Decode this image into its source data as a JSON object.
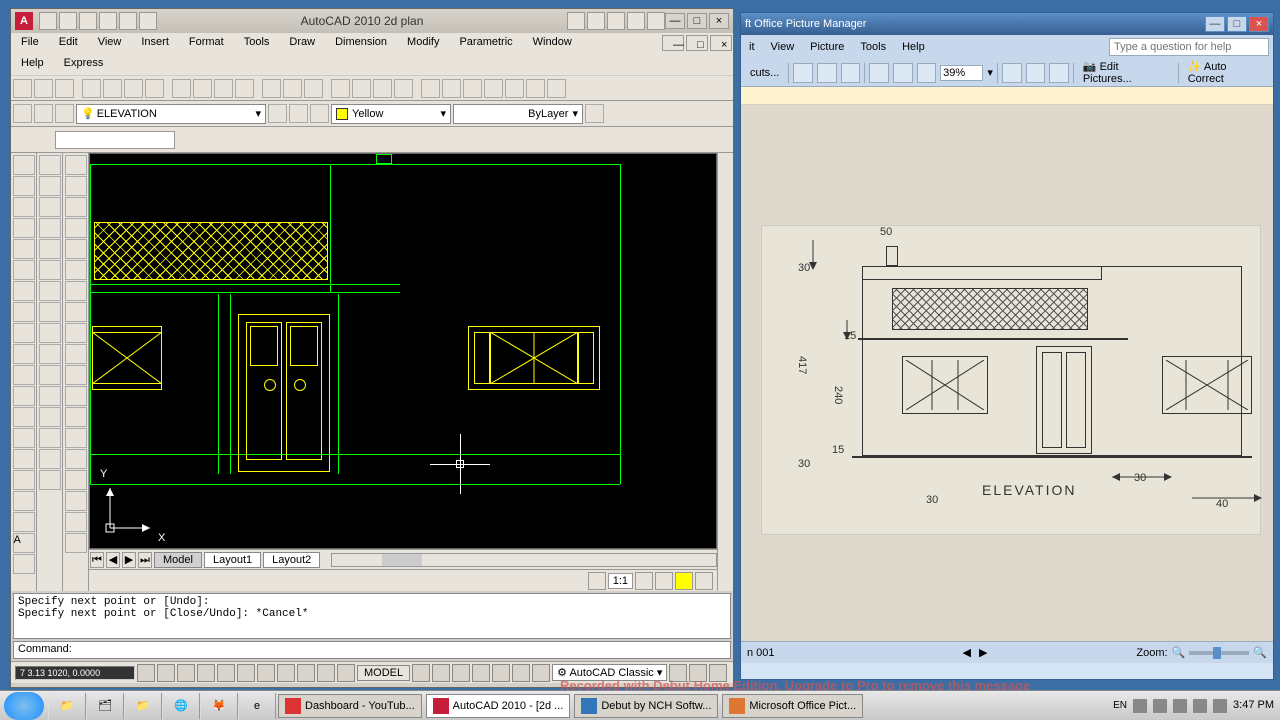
{
  "autocad": {
    "title": "AutoCAD 2010    2d plan",
    "menu": [
      "File",
      "Edit",
      "View",
      "Insert",
      "Format",
      "Tools",
      "Draw",
      "Dimension",
      "Modify",
      "Parametric",
      "Window"
    ],
    "menu2": [
      "Help",
      "Express"
    ],
    "layer": "ELEVATION",
    "color": "Yellow",
    "linetype": "ByLayer",
    "tabs": {
      "nav": [
        "|◀",
        "◀",
        "▶",
        "▶|"
      ],
      "model": "Model",
      "l1": "Layout1",
      "l2": "Layout2"
    },
    "scale": "1:1",
    "cmd_hist": "Specify next point or [Undo]:\nSpecify next point or [Close/Undo]: *Cancel*",
    "cmd_prompt": "Command:",
    "coords": "7   3.13 1020, 0.0000",
    "status_model": "MODEL",
    "status_ws": "AutoCAD Classic",
    "ucs": {
      "x": "X",
      "y": "Y"
    }
  },
  "pm": {
    "title": "ft Office Picture Manager",
    "menu": [
      "it",
      "View",
      "Picture",
      "Tools",
      "Help"
    ],
    "help_ph": "Type a question for help",
    "toolbar": {
      "cuts": "cuts...",
      "zoom": "39%",
      "edit": "Edit Pictures...",
      "auto": "Auto Correct"
    },
    "status": {
      "item": "n 001",
      "zoom": "Zoom:"
    },
    "elev": {
      "title": "ELEVATION",
      "dims": {
        "d50": "50",
        "d30t": "30",
        "d417": "417",
        "d15": "15",
        "d240": "240",
        "d15b": "15",
        "d30b": "30",
        "d30r": "30",
        "d30s": "30",
        "d40": "40"
      }
    }
  },
  "taskbar": {
    "tasks": [
      "Dashboard - YouTub...",
      "AutoCAD 2010 - [2d ...",
      "Debut by NCH Softw...",
      "Microsoft Office Pict..."
    ],
    "lang": "EN",
    "time": "3:47 PM",
    "date": "3:47 PM"
  },
  "watermark": "Recorded with Debut Home Edition. Upgrade to Pro to remove this message"
}
